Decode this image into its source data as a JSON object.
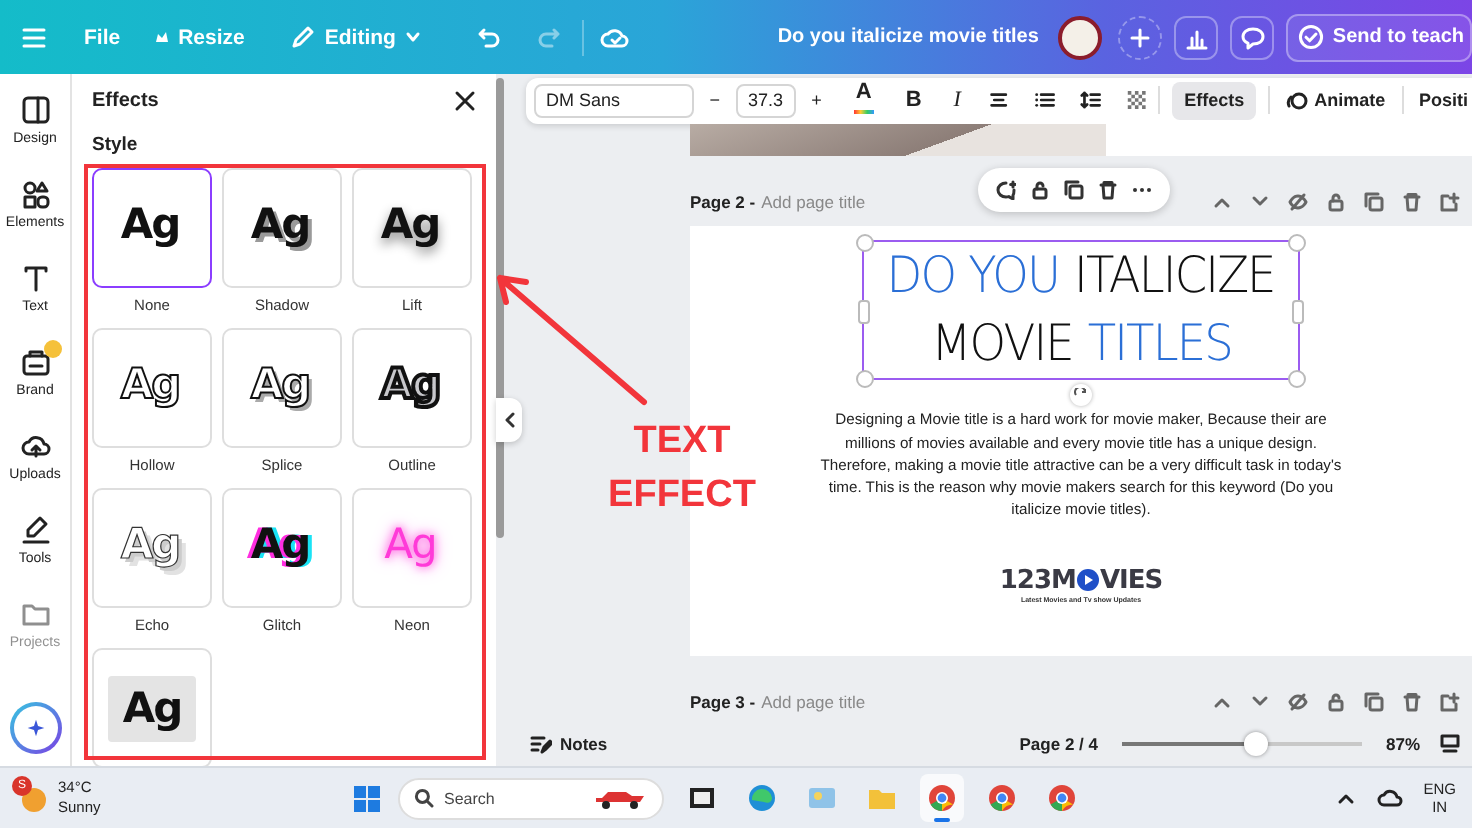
{
  "topbar": {
    "menu_items": [
      {
        "label": "File",
        "kind": "plain"
      },
      {
        "label": "Resize",
        "kind": "crown"
      },
      {
        "label": "Editing",
        "kind": "dropdown"
      }
    ],
    "title": "Do you italicize movie titles",
    "share_button": "Send to teach"
  },
  "rail": [
    {
      "label": "Design",
      "kind": "design",
      "dimmed": false
    },
    {
      "label": "Elements",
      "kind": "elements",
      "dimmed": false
    },
    {
      "label": "Text",
      "kind": "text",
      "dimmed": false
    },
    {
      "label": "Brand",
      "kind": "brand",
      "dimmed": false
    },
    {
      "label": "Uploads",
      "kind": "uploads",
      "dimmed": false
    },
    {
      "label": "Tools",
      "kind": "tools",
      "dimmed": false
    },
    {
      "label": "Projects",
      "kind": "projects",
      "dimmed": true
    }
  ],
  "effects_panel": {
    "title": "Effects",
    "section": "Style",
    "styles": [
      {
        "sample": "Ag",
        "label": "None",
        "kind": "none",
        "selected": true
      },
      {
        "sample": "Ag",
        "label": "Shadow",
        "kind": "shadow",
        "selected": false
      },
      {
        "sample": "Ag",
        "label": "Lift",
        "kind": "lift",
        "selected": false
      },
      {
        "sample": "Ag",
        "label": "Hollow",
        "kind": "hollow",
        "selected": false
      },
      {
        "sample": "Ag",
        "label": "Splice",
        "kind": "splice",
        "selected": false
      },
      {
        "sample": "Ag",
        "label": "Outline",
        "kind": "outline",
        "selected": false
      },
      {
        "sample": "Ag",
        "label": "Echo",
        "kind": "echo",
        "selected": false
      },
      {
        "sample": "Ag",
        "label": "Glitch",
        "kind": "glitch",
        "selected": false
      },
      {
        "sample": "Ag",
        "label": "Neon",
        "kind": "neon",
        "selected": false
      },
      {
        "sample": "Ag",
        "kind": "background",
        "selected": false
      }
    ]
  },
  "toolbar": {
    "font": "DM Sans",
    "minus": "−",
    "size": "37.3",
    "plus": "+",
    "format_buttons": [
      {
        "label": "A",
        "kind": "color"
      },
      {
        "label": "B",
        "kind": "bold"
      },
      {
        "label": "I",
        "kind": "italic"
      }
    ],
    "effects_button": {
      "label": "Effects",
      "selected": true
    },
    "animate_button": "Animate",
    "position_button": "Positi"
  },
  "canvas": {
    "page_2": {
      "label": "Page 2 -",
      "title_placeholder": "Add page title"
    },
    "heading_lines": [
      [
        {
          "text": "DO YOU",
          "color": "#2b6fd6"
        },
        {
          "text": "ITALICIZE",
          "color": "#111111"
        }
      ],
      [
        {
          "text": "MOVIE",
          "color": "#111111"
        },
        {
          "text": "TITLES",
          "color": "#2b6fd6"
        }
      ]
    ],
    "paragraph": "Designing a Movie title is a hard work for movie maker, Because their are millions of movies available and every movie title has a unique design. Therefore, making a movie title attractive can be a very difficult task in today's time. This is the reason why movie makers search for this keyword (Do you italicize movie titles).",
    "logo": {
      "before": "123M",
      "after": "VIES",
      "tagline": "Latest Movies and Tv show Updates"
    },
    "page_3": {
      "label": "Page 3 -",
      "title_placeholder": "Add page title"
    }
  },
  "bottom_bar": {
    "notes": "Notes",
    "page_indicator": "Page 2 / 4",
    "zoom": {
      "level": 0.56
    },
    "zoom_reading": "87%"
  },
  "annotation": {
    "text": "TEXT EFFECT"
  },
  "taskbar": {
    "weather": {
      "badge": "S",
      "temperature": "34°C",
      "condition": "Sunny"
    },
    "search": {
      "placeholder": "Search"
    },
    "apps": [
      {
        "kind": "terminal",
        "active": false
      },
      {
        "kind": "edge",
        "active": false
      },
      {
        "kind": "photos",
        "active": false
      },
      {
        "kind": "folder",
        "active": false
      },
      {
        "kind": "chrome",
        "active": true
      },
      {
        "kind": "chrome",
        "active": false
      },
      {
        "kind": "chrome",
        "active": false
      }
    ],
    "language": "ENG",
    "region": "IN"
  }
}
